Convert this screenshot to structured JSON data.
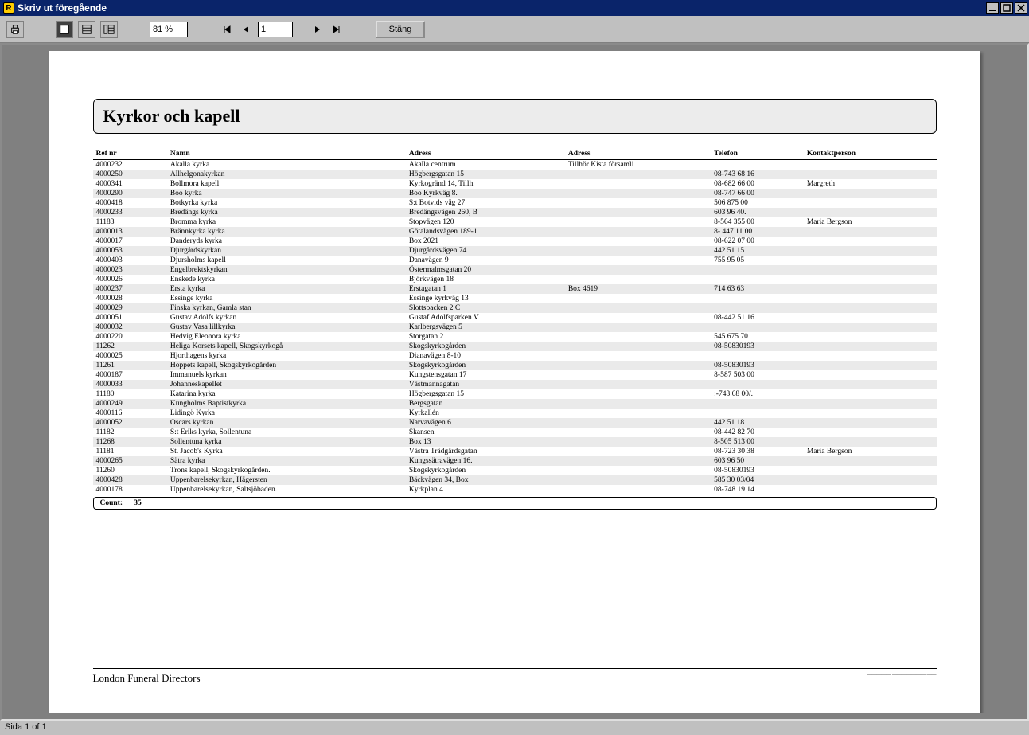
{
  "window": {
    "icon_letter": "R",
    "title": "Skriv ut föregående"
  },
  "toolbar": {
    "zoom_value": "81 %",
    "page_value": "1",
    "close_label": "Stäng"
  },
  "report": {
    "title": "Kyrkor och kapell",
    "columns": {
      "ref": "Ref nr",
      "namn": "Namn",
      "adr1": "Adress",
      "adr2": "Adress",
      "tel": "Telefon",
      "kont": "Kontaktperson"
    },
    "rows": [
      {
        "ref": "4000232",
        "namn": "Akalla kyrka",
        "adr1": "Akalla centrum",
        "adr2": "Tillhör Kista församli",
        "tel": "",
        "kont": ""
      },
      {
        "ref": "4000250",
        "namn": "Allhelgonakyrkan",
        "adr1": "Högbergsgatan 15",
        "adr2": "",
        "tel": "08-743 68 16",
        "kont": ""
      },
      {
        "ref": "4000341",
        "namn": "Bollmora kapell",
        "adr1": "Kyrkogränd 14,   Tillh",
        "adr2": "",
        "tel": "08-682 66 00",
        "kont": "Margreth"
      },
      {
        "ref": "4000290",
        "namn": "Boo kyrka",
        "adr1": "Boo Kyrkväg 8.",
        "adr2": "",
        "tel": "08-747 66 00",
        "kont": ""
      },
      {
        "ref": "4000418",
        "namn": "Botkyrka kyrka",
        "adr1": "S:t Botvids väg 27",
        "adr2": "",
        "tel": "506 875 00",
        "kont": ""
      },
      {
        "ref": "4000233",
        "namn": "Bredängs kyrka",
        "adr1": "Bredängsvägen 260, B",
        "adr2": "",
        "tel": "603 96 40.",
        "kont": ""
      },
      {
        "ref": "11183",
        "namn": "Bromma kyrka",
        "adr1": "Stopvägen 120",
        "adr2": "",
        "tel": "8-564 355 00",
        "kont": "Maria Bergson"
      },
      {
        "ref": "4000013",
        "namn": "Brännkyrka kyrka",
        "adr1": "Götalandsvägen 189-1",
        "adr2": "",
        "tel": "8- 447 11 00",
        "kont": ""
      },
      {
        "ref": "4000017",
        "namn": "Danderyds kyrka",
        "adr1": "Box 2021",
        "adr2": "",
        "tel": "08-622 07 00",
        "kont": ""
      },
      {
        "ref": "4000053",
        "namn": "Djurgårdskyrkan",
        "adr1": "Djurgårdsvägen 74",
        "adr2": "",
        "tel": "442 51 15",
        "kont": ""
      },
      {
        "ref": "4000403",
        "namn": "Djursholms kapell",
        "adr1": "Danavägen 9",
        "adr2": "",
        "tel": "755 95 05",
        "kont": ""
      },
      {
        "ref": "4000023",
        "namn": "Engelbrektskyrkan",
        "adr1": "Östermalmsgatan 20",
        "adr2": "",
        "tel": "",
        "kont": ""
      },
      {
        "ref": "4000026",
        "namn": "Enskede kyrka",
        "adr1": "Björkvägen 18",
        "adr2": "",
        "tel": "",
        "kont": ""
      },
      {
        "ref": "4000237",
        "namn": "Ersta kyrka",
        "adr1": "Erstagatan 1",
        "adr2": "Box 4619",
        "tel": "714 63 63",
        "kont": ""
      },
      {
        "ref": "4000028",
        "namn": "Essinge kyrka",
        "adr1": "Essinge kyrkväg 13",
        "adr2": "",
        "tel": "",
        "kont": ""
      },
      {
        "ref": "4000029",
        "namn": "Finska kyrkan, Gamla stan",
        "adr1": "Slottsbacken 2 C",
        "adr2": "",
        "tel": "",
        "kont": ""
      },
      {
        "ref": "4000051",
        "namn": "Gustav Adolfs kyrkan",
        "adr1": "Gustaf Adolfsparken V",
        "adr2": "",
        "tel": "08-442 51 16",
        "kont": ""
      },
      {
        "ref": "4000032",
        "namn": "Gustav Vasa lillkyrka",
        "adr1": "Karlbergsvägen 5",
        "adr2": "",
        "tel": "",
        "kont": ""
      },
      {
        "ref": "4000220",
        "namn": "Hedvig Eleonora kyrka",
        "adr1": "Storgatan 2",
        "adr2": "",
        "tel": "545 675 70",
        "kont": ""
      },
      {
        "ref": "11262",
        "namn": "Heliga Korsets kapell, Skogskyrkogå",
        "adr1": "Skogskyrkogården",
        "adr2": "",
        "tel": "08-50830193",
        "kont": ""
      },
      {
        "ref": "4000025",
        "namn": "Hjorthagens kyrka",
        "adr1": "Dianavägen 8-10",
        "adr2": "",
        "tel": "",
        "kont": ""
      },
      {
        "ref": "11261",
        "namn": "Hoppets kapell, Skogskyrkogården",
        "adr1": "Skogskyrkogården",
        "adr2": "",
        "tel": "08-50830193",
        "kont": ""
      },
      {
        "ref": "4000187",
        "namn": "Immanuels kyrkan",
        "adr1": "Kungstensgatan 17",
        "adr2": "",
        "tel": "8-587 503 00",
        "kont": ""
      },
      {
        "ref": "4000033",
        "namn": "Johanneskapellet",
        "adr1": "Västmannagatan",
        "adr2": "",
        "tel": "",
        "kont": ""
      },
      {
        "ref": "11180",
        "namn": "Katarina kyrka",
        "adr1": "Högbergsgatan 15",
        "adr2": "",
        "tel": ":-743 68 00/.",
        "kont": ""
      },
      {
        "ref": "4000249",
        "namn": "Kungholms Baptistkyrka",
        "adr1": "Bergsgatan",
        "adr2": "",
        "tel": "",
        "kont": ""
      },
      {
        "ref": "4000116",
        "namn": "Lidingö Kyrka",
        "adr1": "Kyrkallén",
        "adr2": "",
        "tel": "",
        "kont": ""
      },
      {
        "ref": "4000052",
        "namn": "Oscars kyrkan",
        "adr1": "Narvavägen 6",
        "adr2": "",
        "tel": "442 51 18",
        "kont": ""
      },
      {
        "ref": "11182",
        "namn": "S:t Eriks kyrka, Sollentuna",
        "adr1": "Skansen",
        "adr2": "",
        "tel": "08-442 82 70",
        "kont": ""
      },
      {
        "ref": "11268",
        "namn": "Sollentuna kyrka",
        "adr1": "Box 13",
        "adr2": "",
        "tel": "8-505 513 00",
        "kont": ""
      },
      {
        "ref": "11181",
        "namn": "St. Jacob's Kyrka",
        "adr1": "Västra Trädgårdsgatan",
        "adr2": "",
        "tel": "08-723 30 38",
        "kont": "Maria Bergson"
      },
      {
        "ref": "4000265",
        "namn": "Sätra kyrka",
        "adr1": "Kungssätravägen 16.",
        "adr2": "",
        "tel": "603 96 50",
        "kont": ""
      },
      {
        "ref": "11260",
        "namn": "Trons kapell, Skogskyrkogården.",
        "adr1": "Skogskyrkogården",
        "adr2": "",
        "tel": "08-50830193",
        "kont": ""
      },
      {
        "ref": "4000428",
        "namn": "Uppenbarelsekyrkan, Hägersten",
        "adr1": "Bäckvägen 34,    Box",
        "adr2": "",
        "tel": "585 30 03/04",
        "kont": ""
      },
      {
        "ref": "4000178",
        "namn": "Uppenbarelsekyrkan, Saltsjöbaden.",
        "adr1": "Kyrkplan 4",
        "adr2": "",
        "tel": "08-748 19 14",
        "kont": ""
      }
    ],
    "count_label": "Count:",
    "count_value": "35",
    "footer": "London Funeral Directors"
  },
  "status": {
    "text": "Sida 1 of 1"
  }
}
